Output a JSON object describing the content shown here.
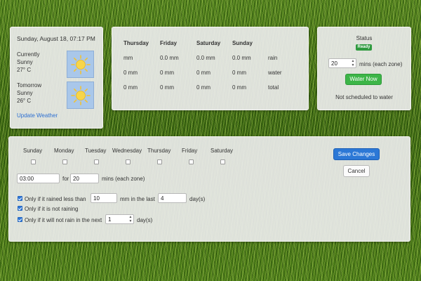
{
  "weather": {
    "datetime": "Sunday, August 18, 07:17 PM",
    "current": {
      "label": "Currently",
      "condition": "Sunny",
      "temp": "27° C",
      "icon": "sunny-icon"
    },
    "tomorrow": {
      "label": "Tomorrow",
      "condition": "Sunny",
      "temp": "26° C",
      "icon": "sunny-icon"
    },
    "update_link": "Update Weather"
  },
  "rain_table": {
    "headers": [
      "Thursday",
      "Friday",
      "Saturday",
      "Sunday"
    ],
    "rows": [
      {
        "values": [
          "mm",
          "0.0 mm",
          "0.0 mm",
          "0.0 mm"
        ],
        "label": "rain"
      },
      {
        "values": [
          "0 mm",
          "0 mm",
          "0 mm",
          "0 mm"
        ],
        "label": "water"
      },
      {
        "values": [
          "0 mm",
          "0 mm",
          "0 mm",
          "0 mm"
        ],
        "label": "total"
      }
    ]
  },
  "status": {
    "title": "Status",
    "badge": "Ready",
    "mins_value": "20",
    "mins_label": "mins (each zone)",
    "water_now": "Water Now",
    "schedule_note": "Not scheduled to water"
  },
  "schedule": {
    "days": [
      {
        "name": "Sunday",
        "checked": false
      },
      {
        "name": "Monday",
        "checked": false
      },
      {
        "name": "Tuesday",
        "checked": false
      },
      {
        "name": "Wednesday",
        "checked": false
      },
      {
        "name": "Thursday",
        "checked": false
      },
      {
        "name": "Friday",
        "checked": false
      },
      {
        "name": "Saturday",
        "checked": false
      }
    ],
    "start_time": "03:00",
    "for_label": "for",
    "duration": "20",
    "duration_label": "mins (each zone)",
    "conditions": {
      "rained": {
        "checked": true,
        "prefix": "Only if it rained less than",
        "mm_value": "10",
        "middle": "mm in the last",
        "days_value": "4",
        "suffix": "day(s)"
      },
      "not_raining": {
        "checked": true,
        "label": "Only if it is not raining"
      },
      "will_not_rain": {
        "checked": true,
        "prefix": "Only if it will not rain in the next",
        "days_value": "1",
        "suffix": "day(s)"
      }
    },
    "save_label": "Save Changes",
    "cancel_label": "Cancel"
  },
  "colors": {
    "accent_blue": "#2c78d6",
    "ready_green": "#2e9a3e",
    "water_green": "#3db548",
    "link_blue": "#2d6fd2"
  }
}
